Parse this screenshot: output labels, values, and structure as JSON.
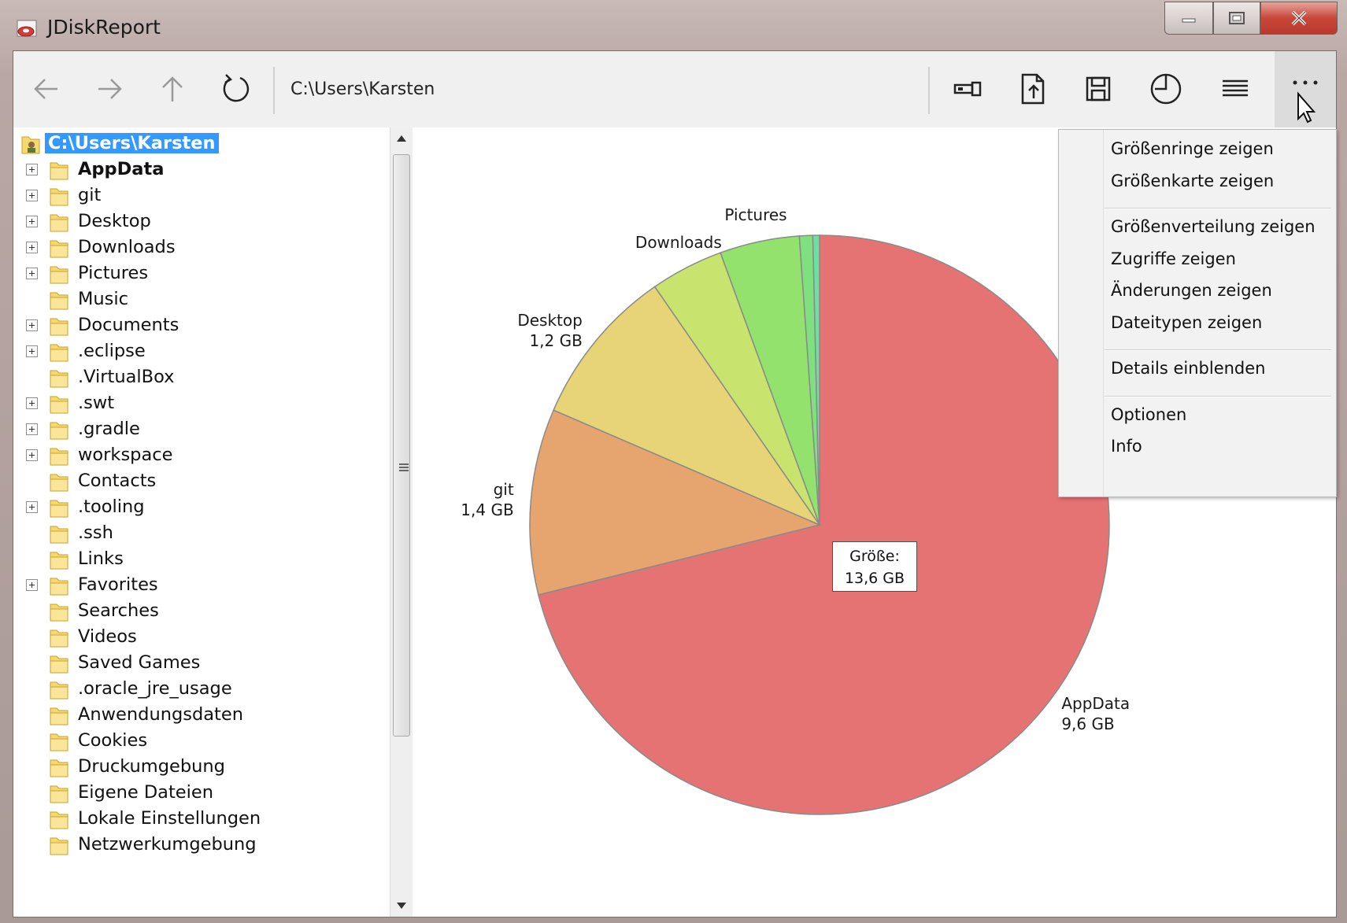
{
  "window": {
    "title": "JDiskReport"
  },
  "toolbar": {
    "path": "C:\\Users\\Karsten",
    "back_icon": "arrow-left-icon",
    "forward_icon": "arrow-right-icon",
    "up_icon": "arrow-up-icon",
    "refresh_icon": "refresh-icon",
    "scan_icon": "flashlight-icon",
    "open_icon": "open-file-icon",
    "save_icon": "save-icon",
    "pie_icon": "pie-chart-icon",
    "list_icon": "list-icon",
    "more_icon": "more-icon"
  },
  "tree": {
    "root": "C:\\Users\\Karsten",
    "items": [
      {
        "label": "AppData",
        "expandable": true,
        "bold": true
      },
      {
        "label": "git",
        "expandable": true
      },
      {
        "label": "Desktop",
        "expandable": true
      },
      {
        "label": "Downloads",
        "expandable": true
      },
      {
        "label": "Pictures",
        "expandable": true
      },
      {
        "label": "Music",
        "expandable": false
      },
      {
        "label": "Documents",
        "expandable": true
      },
      {
        "label": ".eclipse",
        "expandable": true
      },
      {
        "label": ".VirtualBox",
        "expandable": false
      },
      {
        "label": ".swt",
        "expandable": true
      },
      {
        "label": ".gradle",
        "expandable": true
      },
      {
        "label": "workspace",
        "expandable": true
      },
      {
        "label": "Contacts",
        "expandable": false
      },
      {
        "label": ".tooling",
        "expandable": true
      },
      {
        "label": ".ssh",
        "expandable": false
      },
      {
        "label": "Links",
        "expandable": false
      },
      {
        "label": "Favorites",
        "expandable": true
      },
      {
        "label": "Searches",
        "expandable": false
      },
      {
        "label": "Videos",
        "expandable": false
      },
      {
        "label": "Saved Games",
        "expandable": false
      },
      {
        "label": ".oracle_jre_usage",
        "expandable": false
      },
      {
        "label": "Anwendungsdaten",
        "expandable": false
      },
      {
        "label": "Cookies",
        "expandable": false
      },
      {
        "label": "Druckumgebung",
        "expandable": false
      },
      {
        "label": "Eigene Dateien",
        "expandable": false
      },
      {
        "label": "Lokale Einstellungen",
        "expandable": false
      },
      {
        "label": "Netzwerkumgebung",
        "expandable": false
      }
    ]
  },
  "chart_data": {
    "type": "pie",
    "total_label": "Größe:",
    "total_value": "13,6 GB",
    "slices": [
      {
        "name": "AppData",
        "value": 9.6,
        "value_label": "9,6 GB",
        "color": "#e57373"
      },
      {
        "name": "git",
        "value": 1.4,
        "value_label": "1,4 GB",
        "color": "#e6a56f"
      },
      {
        "name": "Desktop",
        "value": 1.2,
        "value_label": "1,2 GB",
        "color": "#e6d476"
      },
      {
        "name": "Downloads",
        "value": 0.55,
        "value_label": "",
        "color": "#c9e46e"
      },
      {
        "name": "Pictures",
        "value": 0.6,
        "value_label": "",
        "color": "#93e26e"
      },
      {
        "name": "",
        "value": 0.1,
        "value_label": "",
        "color": "#7fe07f"
      },
      {
        "name": "",
        "value": 0.05,
        "value_label": "",
        "color": "#6de0a0"
      }
    ]
  },
  "menu": {
    "groups": [
      [
        "Größenringe zeigen",
        "Größenkarte zeigen"
      ],
      [
        "Größenverteilung zeigen",
        "Zugriffe zeigen",
        "Änderungen zeigen",
        "Dateitypen zeigen"
      ],
      [
        "Details einblenden"
      ],
      [
        "Optionen",
        "Info"
      ]
    ]
  }
}
